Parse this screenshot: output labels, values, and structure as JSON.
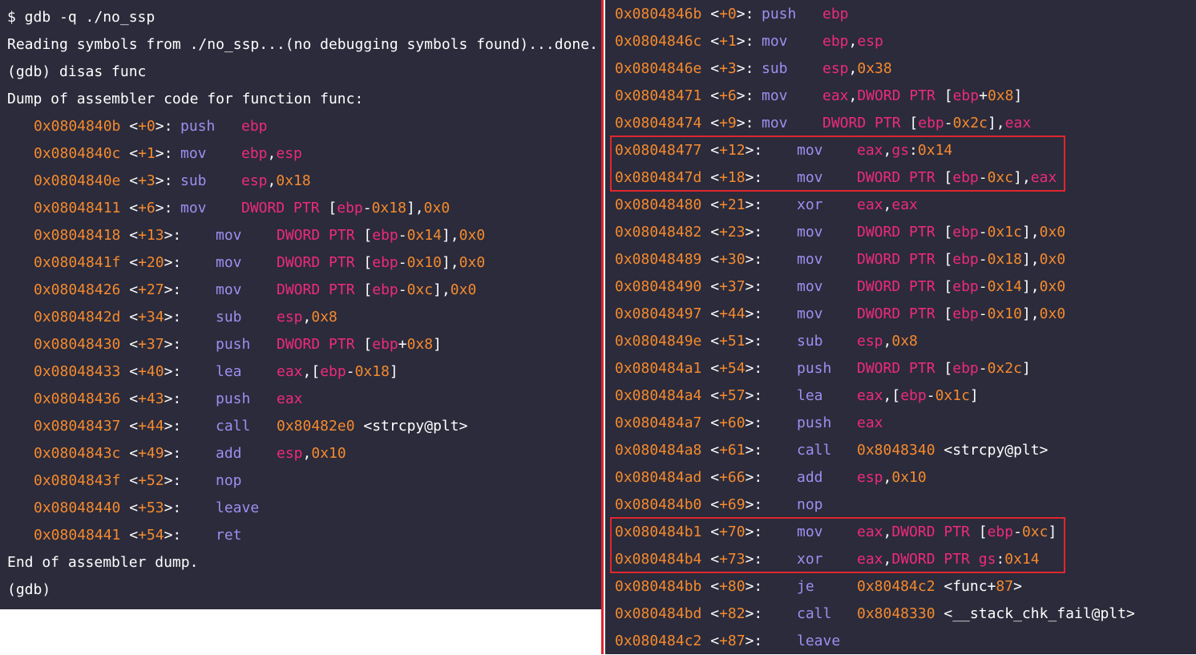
{
  "left": {
    "header": [
      "$ gdb -q ./no_ssp",
      "Reading symbols from ./no_ssp...(no debugging symbols found)...done.",
      "(gdb) disas func",
      "Dump of assembler code for function func:"
    ],
    "lines": [
      {
        "addr": "0x0804840b",
        "off": "+0",
        "mn": "push",
        "ops": [
          [
            "reg",
            "ebp"
          ]
        ]
      },
      {
        "addr": "0x0804840c",
        "off": "+1",
        "mn": "mov",
        "ops": [
          [
            "reg",
            "ebp"
          ],
          [
            "pl",
            ","
          ],
          [
            "reg",
            "esp"
          ]
        ]
      },
      {
        "addr": "0x0804840e",
        "off": "+3",
        "mn": "sub",
        "ops": [
          [
            "reg",
            "esp"
          ],
          [
            "pl",
            ","
          ],
          [
            "num",
            "0x18"
          ]
        ]
      },
      {
        "addr": "0x08048411",
        "off": "+6",
        "mn": "mov",
        "ops": [
          [
            "kw",
            "DWORD PTR"
          ],
          [
            "pl",
            " ["
          ],
          [
            "reg",
            "ebp"
          ],
          [
            "pl",
            "-"
          ],
          [
            "num",
            "0x18"
          ],
          [
            "pl",
            "],"
          ],
          [
            "num",
            "0x0"
          ]
        ]
      },
      {
        "addr": "0x08048418",
        "off": "+13",
        "mn": "mov",
        "ops": [
          [
            "kw",
            "DWORD PTR"
          ],
          [
            "pl",
            " ["
          ],
          [
            "reg",
            "ebp"
          ],
          [
            "pl",
            "-"
          ],
          [
            "num",
            "0x14"
          ],
          [
            "pl",
            "],"
          ],
          [
            "num",
            "0x0"
          ]
        ]
      },
      {
        "addr": "0x0804841f",
        "off": "+20",
        "mn": "mov",
        "ops": [
          [
            "kw",
            "DWORD PTR"
          ],
          [
            "pl",
            " ["
          ],
          [
            "reg",
            "ebp"
          ],
          [
            "pl",
            "-"
          ],
          [
            "num",
            "0x10"
          ],
          [
            "pl",
            "],"
          ],
          [
            "num",
            "0x0"
          ]
        ]
      },
      {
        "addr": "0x08048426",
        "off": "+27",
        "mn": "mov",
        "ops": [
          [
            "kw",
            "DWORD PTR"
          ],
          [
            "pl",
            " ["
          ],
          [
            "reg",
            "ebp"
          ],
          [
            "pl",
            "-"
          ],
          [
            "num",
            "0xc"
          ],
          [
            "pl",
            "],"
          ],
          [
            "num",
            "0x0"
          ]
        ]
      },
      {
        "addr": "0x0804842d",
        "off": "+34",
        "mn": "sub",
        "ops": [
          [
            "reg",
            "esp"
          ],
          [
            "pl",
            ","
          ],
          [
            "num",
            "0x8"
          ]
        ]
      },
      {
        "addr": "0x08048430",
        "off": "+37",
        "mn": "push",
        "ops": [
          [
            "kw",
            "DWORD PTR"
          ],
          [
            "pl",
            " ["
          ],
          [
            "reg",
            "ebp"
          ],
          [
            "pl",
            "+"
          ],
          [
            "num",
            "0x8"
          ],
          [
            "pl",
            "]"
          ]
        ]
      },
      {
        "addr": "0x08048433",
        "off": "+40",
        "mn": "lea",
        "ops": [
          [
            "reg",
            "eax"
          ],
          [
            "pl",
            ",["
          ],
          [
            "reg",
            "ebp"
          ],
          [
            "pl",
            "-"
          ],
          [
            "num",
            "0x18"
          ],
          [
            "pl",
            "]"
          ]
        ]
      },
      {
        "addr": "0x08048436",
        "off": "+43",
        "mn": "push",
        "ops": [
          [
            "reg",
            "eax"
          ]
        ]
      },
      {
        "addr": "0x08048437",
        "off": "+44",
        "mn": "call",
        "ops": [
          [
            "num",
            "0x80482e0"
          ],
          [
            "pl",
            " <strcpy@plt>"
          ]
        ]
      },
      {
        "addr": "0x0804843c",
        "off": "+49",
        "mn": "add",
        "ops": [
          [
            "reg",
            "esp"
          ],
          [
            "pl",
            ","
          ],
          [
            "num",
            "0x10"
          ]
        ]
      },
      {
        "addr": "0x0804843f",
        "off": "+52",
        "mn": "nop",
        "ops": []
      },
      {
        "addr": "0x08048440",
        "off": "+53",
        "mn": "leave",
        "ops": []
      },
      {
        "addr": "0x08048441",
        "off": "+54",
        "mn": "ret",
        "ops": []
      }
    ],
    "footer": [
      "End of assembler dump.",
      "(gdb)"
    ]
  },
  "right": {
    "lines": [
      {
        "addr": "0x0804846b",
        "off": "+0",
        "mn": "push",
        "ops": [
          [
            "reg",
            "ebp"
          ]
        ]
      },
      {
        "addr": "0x0804846c",
        "off": "+1",
        "mn": "mov",
        "ops": [
          [
            "reg",
            "ebp"
          ],
          [
            "pl",
            ","
          ],
          [
            "reg",
            "esp"
          ]
        ]
      },
      {
        "addr": "0x0804846e",
        "off": "+3",
        "mn": "sub",
        "ops": [
          [
            "reg",
            "esp"
          ],
          [
            "pl",
            ","
          ],
          [
            "num",
            "0x38"
          ]
        ]
      },
      {
        "addr": "0x08048471",
        "off": "+6",
        "mn": "mov",
        "ops": [
          [
            "reg",
            "eax"
          ],
          [
            "pl",
            ","
          ],
          [
            "kw",
            "DWORD PTR"
          ],
          [
            "pl",
            " ["
          ],
          [
            "reg",
            "ebp"
          ],
          [
            "pl",
            "+"
          ],
          [
            "num",
            "0x8"
          ],
          [
            "pl",
            "]"
          ]
        ]
      },
      {
        "addr": "0x08048474",
        "off": "+9",
        "mn": "mov",
        "ops": [
          [
            "kw",
            "DWORD PTR"
          ],
          [
            "pl",
            " ["
          ],
          [
            "reg",
            "ebp"
          ],
          [
            "pl",
            "-"
          ],
          [
            "num",
            "0x2c"
          ],
          [
            "pl",
            "],"
          ],
          [
            "reg",
            "eax"
          ]
        ]
      },
      {
        "addr": "0x08048477",
        "off": "+12",
        "mn": "mov",
        "ops": [
          [
            "reg",
            "eax"
          ],
          [
            "pl",
            ","
          ],
          [
            "reg",
            "gs"
          ],
          [
            "pl",
            ":"
          ],
          [
            "num",
            "0x14"
          ]
        ]
      },
      {
        "addr": "0x0804847d",
        "off": "+18",
        "mn": "mov",
        "ops": [
          [
            "kw",
            "DWORD PTR"
          ],
          [
            "pl",
            " ["
          ],
          [
            "reg",
            "ebp"
          ],
          [
            "pl",
            "-"
          ],
          [
            "num",
            "0xc"
          ],
          [
            "pl",
            "],"
          ],
          [
            "reg",
            "eax"
          ]
        ]
      },
      {
        "addr": "0x08048480",
        "off": "+21",
        "mn": "xor",
        "ops": [
          [
            "reg",
            "eax"
          ],
          [
            "pl",
            ","
          ],
          [
            "reg",
            "eax"
          ]
        ]
      },
      {
        "addr": "0x08048482",
        "off": "+23",
        "mn": "mov",
        "ops": [
          [
            "kw",
            "DWORD PTR"
          ],
          [
            "pl",
            " ["
          ],
          [
            "reg",
            "ebp"
          ],
          [
            "pl",
            "-"
          ],
          [
            "num",
            "0x1c"
          ],
          [
            "pl",
            "],"
          ],
          [
            "num",
            "0x0"
          ]
        ]
      },
      {
        "addr": "0x08048489",
        "off": "+30",
        "mn": "mov",
        "ops": [
          [
            "kw",
            "DWORD PTR"
          ],
          [
            "pl",
            " ["
          ],
          [
            "reg",
            "ebp"
          ],
          [
            "pl",
            "-"
          ],
          [
            "num",
            "0x18"
          ],
          [
            "pl",
            "],"
          ],
          [
            "num",
            "0x0"
          ]
        ]
      },
      {
        "addr": "0x08048490",
        "off": "+37",
        "mn": "mov",
        "ops": [
          [
            "kw",
            "DWORD PTR"
          ],
          [
            "pl",
            " ["
          ],
          [
            "reg",
            "ebp"
          ],
          [
            "pl",
            "-"
          ],
          [
            "num",
            "0x14"
          ],
          [
            "pl",
            "],"
          ],
          [
            "num",
            "0x0"
          ]
        ]
      },
      {
        "addr": "0x08048497",
        "off": "+44",
        "mn": "mov",
        "ops": [
          [
            "kw",
            "DWORD PTR"
          ],
          [
            "pl",
            " ["
          ],
          [
            "reg",
            "ebp"
          ],
          [
            "pl",
            "-"
          ],
          [
            "num",
            "0x10"
          ],
          [
            "pl",
            "],"
          ],
          [
            "num",
            "0x0"
          ]
        ]
      },
      {
        "addr": "0x0804849e",
        "off": "+51",
        "mn": "sub",
        "ops": [
          [
            "reg",
            "esp"
          ],
          [
            "pl",
            ","
          ],
          [
            "num",
            "0x8"
          ]
        ]
      },
      {
        "addr": "0x080484a1",
        "off": "+54",
        "mn": "push",
        "ops": [
          [
            "kw",
            "DWORD PTR"
          ],
          [
            "pl",
            " ["
          ],
          [
            "reg",
            "ebp"
          ],
          [
            "pl",
            "-"
          ],
          [
            "num",
            "0x2c"
          ],
          [
            "pl",
            "]"
          ]
        ]
      },
      {
        "addr": "0x080484a4",
        "off": "+57",
        "mn": "lea",
        "ops": [
          [
            "reg",
            "eax"
          ],
          [
            "pl",
            ",["
          ],
          [
            "reg",
            "ebp"
          ],
          [
            "pl",
            "-"
          ],
          [
            "num",
            "0x1c"
          ],
          [
            "pl",
            "]"
          ]
        ]
      },
      {
        "addr": "0x080484a7",
        "off": "+60",
        "mn": "push",
        "ops": [
          [
            "reg",
            "eax"
          ]
        ]
      },
      {
        "addr": "0x080484a8",
        "off": "+61",
        "mn": "call",
        "ops": [
          [
            "num",
            "0x8048340"
          ],
          [
            "pl",
            " <strcpy@plt>"
          ]
        ]
      },
      {
        "addr": "0x080484ad",
        "off": "+66",
        "mn": "add",
        "ops": [
          [
            "reg",
            "esp"
          ],
          [
            "pl",
            ","
          ],
          [
            "num",
            "0x10"
          ]
        ]
      },
      {
        "addr": "0x080484b0",
        "off": "+69",
        "mn": "nop",
        "ops": []
      },
      {
        "addr": "0x080484b1",
        "off": "+70",
        "mn": "mov",
        "ops": [
          [
            "reg",
            "eax"
          ],
          [
            "pl",
            ","
          ],
          [
            "kw",
            "DWORD PTR"
          ],
          [
            "pl",
            " ["
          ],
          [
            "reg",
            "ebp"
          ],
          [
            "pl",
            "-"
          ],
          [
            "num",
            "0xc"
          ],
          [
            "pl",
            "]"
          ]
        ]
      },
      {
        "addr": "0x080484b4",
        "off": "+73",
        "mn": "xor",
        "ops": [
          [
            "reg",
            "eax"
          ],
          [
            "pl",
            ","
          ],
          [
            "kw",
            "DWORD PTR"
          ],
          [
            "pl",
            " "
          ],
          [
            "reg",
            "gs"
          ],
          [
            "pl",
            ":"
          ],
          [
            "num",
            "0x14"
          ]
        ]
      },
      {
        "addr": "0x080484bb",
        "off": "+80",
        "mn": "je",
        "ops": [
          [
            "num",
            "0x80484c2"
          ],
          [
            "pl",
            " <func+"
          ],
          [
            "num",
            "87"
          ],
          [
            "pl",
            ">"
          ]
        ]
      },
      {
        "addr": "0x080484bd",
        "off": "+82",
        "mn": "call",
        "ops": [
          [
            "num",
            "0x8048330"
          ],
          [
            "pl",
            " <__stack_chk_fail@plt>"
          ]
        ]
      },
      {
        "addr": "0x080484c2",
        "off": "+87",
        "mn": "leave",
        "ops": []
      }
    ]
  },
  "colors": {
    "background": "#2b2b3b",
    "address": "#f58a2e",
    "register": "#ee2a7b",
    "mnemonic": "#9d8ff0",
    "text": "#ffffff",
    "highlight_border": "#e0262e"
  }
}
